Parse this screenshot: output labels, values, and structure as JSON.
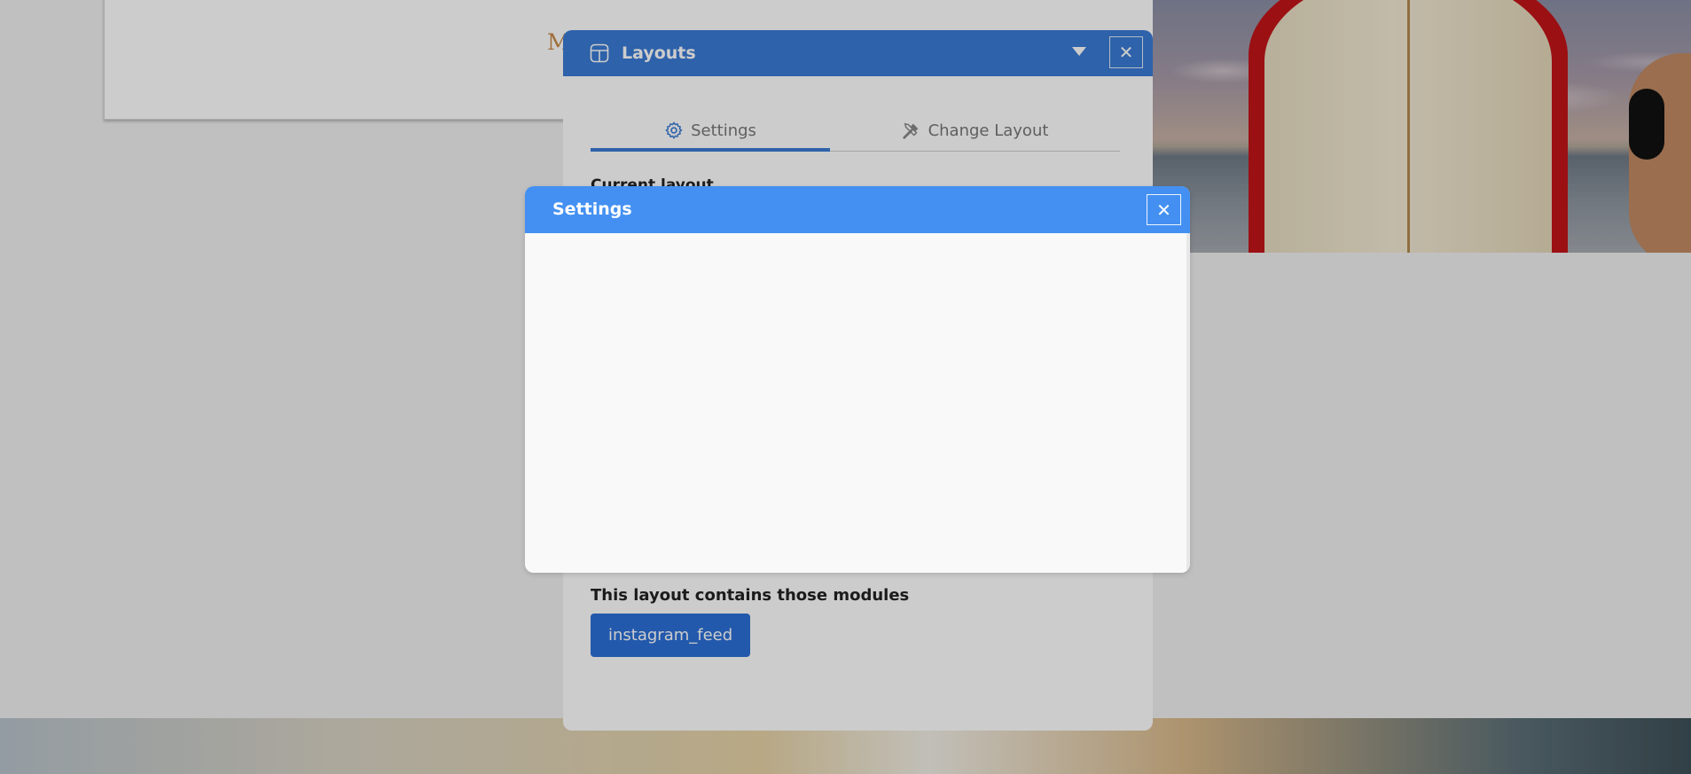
{
  "background": {
    "card_partial_text": "M"
  },
  "layouts_panel": {
    "title": "Layouts",
    "close_symbol": "✕",
    "tabs": [
      {
        "label": "Settings",
        "icon": "gear-icon",
        "active": true
      },
      {
        "label": "Change Layout",
        "icon": "tools-icon",
        "active": false
      }
    ],
    "current_layout_label": "Current layout",
    "modules_heading": "This layout contains those modules",
    "modules": [
      "instagram_feed"
    ]
  },
  "settings_dialog": {
    "title": "Settings",
    "close_symbol": "✕"
  },
  "colors": {
    "panel_header": "#3a7bd5",
    "dialog_header": "#4490f2",
    "module_chip": "#2c70d8",
    "accent_text": "#c88a4a"
  }
}
